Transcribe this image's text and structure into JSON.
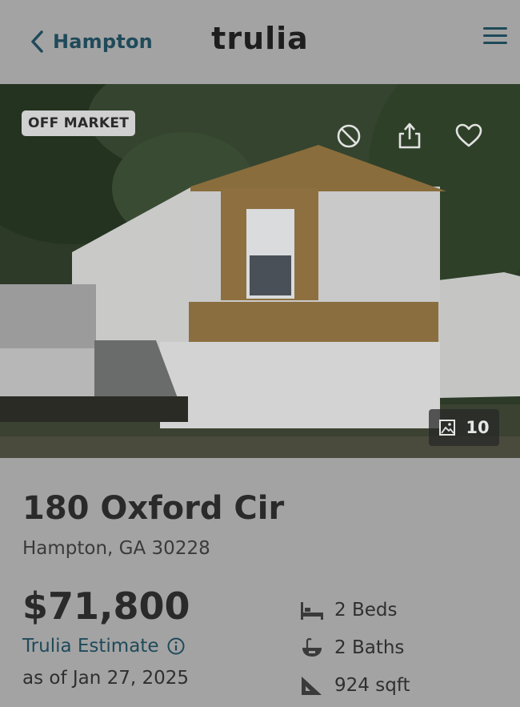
{
  "header": {
    "back_label": "Hampton",
    "logo_text": "trulia"
  },
  "photo": {
    "status_badge": "OFF MARKET",
    "photo_count": "10",
    "actions": [
      "hide-icon",
      "share-icon",
      "heart-icon"
    ]
  },
  "listing": {
    "address": "180 Oxford Cir",
    "city_state_zip": "Hampton, GA 30228",
    "price": "$71,800",
    "estimate_label": "Trulia Estimate",
    "as_of": "as of Jan 27, 2025",
    "beds": "2 Beds",
    "baths": "2 Baths",
    "sqft": "924 sqft"
  },
  "colors": {
    "accent": "#1f4a5a",
    "background": "#a3a3a3"
  }
}
